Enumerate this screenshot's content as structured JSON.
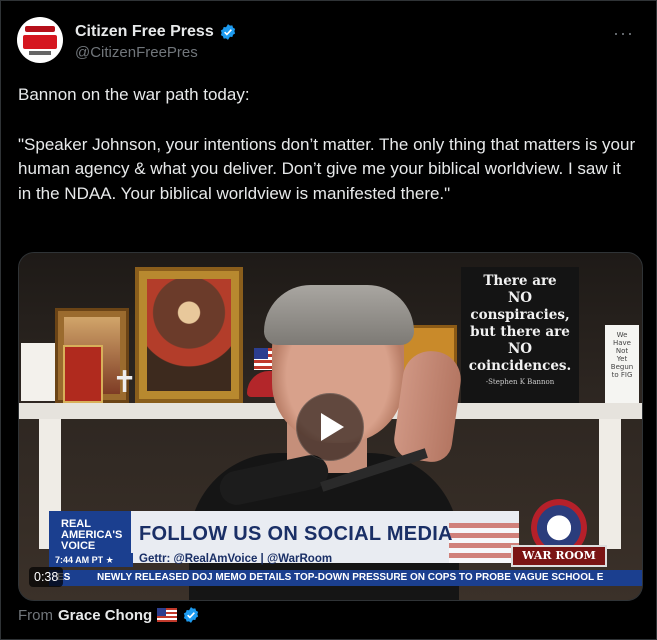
{
  "header": {
    "display_name": "Citizen Free Press",
    "handle": "@CitizenFreePres",
    "more_label": "···"
  },
  "tweet": {
    "line1": "Bannon on the war path today:",
    "line2": "\"Speaker Johnson, your intentions don’t matter. The only thing that matters is your human agency & what you deliver. Don’t give me your biblical worldview. I saw it in the NDAA. Your biblical worldview is manifested there.\""
  },
  "video": {
    "duration": "0:38",
    "sign_text": [
      "There are",
      "NO",
      "conspiracies,",
      "but there are",
      "NO",
      "coincidences."
    ],
    "sign_signature": "-Stephen K Bannon",
    "right_card": [
      "We",
      "Have",
      "Not",
      "Yet",
      "Begun",
      "to FIG"
    ],
    "channel_logo": [
      "REAL",
      "AMERICA'S",
      "VOICE"
    ],
    "lower_third_title": "FOLLOW US ON SOCIAL MEDIA",
    "lower_third_sub": "Gettr: @RealAmVoice | @WarRoom",
    "time": "7:44 AM PT ★",
    "ticker": "NEWLY RELEASED DOJ MEMO DETAILS TOP-DOWN PRESSURE ON COPS TO PROBE VAGUE SCHOOL E",
    "ticker_prefix": "ES",
    "warroom_label": "WAR ROOM"
  },
  "attribution": {
    "from_label": "From",
    "from_name": "Grace Chong"
  },
  "colors": {
    "background": "#000000",
    "text": "#e7e9ea",
    "muted": "#71767b",
    "verified": "#1d9bf0"
  }
}
